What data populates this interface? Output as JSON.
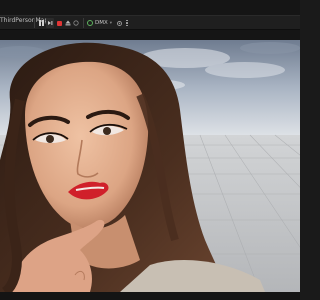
{
  "toolbar": {
    "level_label": "ThirdPersonMap",
    "play_mode": "DMX",
    "icons": {
      "dropdown": "chevron-down-icon",
      "pause": "pause-icon",
      "stop": "stop-icon",
      "eject": "eject-icon",
      "mode": "globe-icon",
      "frame": "frame-icon",
      "more": "kebab-icon"
    },
    "colors": {
      "stop": "#e03535",
      "mode_icon": "#5fb35f",
      "background": "#1f1f1f"
    }
  },
  "viewport": {
    "content": "portrait-image",
    "colors": {
      "sky": "#aeb8c6",
      "floor": "#c9ccd0",
      "lips": "#d0202a"
    }
  }
}
